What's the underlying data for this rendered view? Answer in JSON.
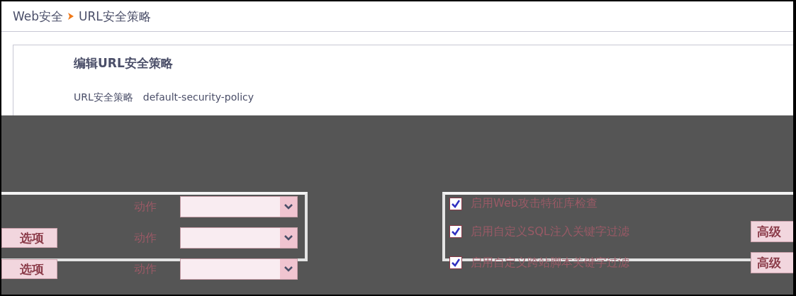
{
  "breadcrumb": [
    {
      "label": "Web安全"
    },
    {
      "label": "URL安全策略"
    }
  ],
  "title": "编辑URL安全策略",
  "policy": {
    "label": "URL安全策略",
    "value": "default-security-policy"
  },
  "action_rows": [
    {
      "label": "动作"
    },
    {
      "option_button": "选项",
      "label": "动作"
    },
    {
      "option_button": "选项",
      "label": "动作"
    }
  ],
  "checks": [
    {
      "label": "启用Web攻击特征库检查",
      "checked": true
    },
    {
      "label": "启用自定义SQL注入关键字过滤",
      "checked": true,
      "button": "高级"
    },
    {
      "label": "启用自定义跨站脚本关键字过滤",
      "checked": true,
      "button": "高级"
    }
  ]
}
